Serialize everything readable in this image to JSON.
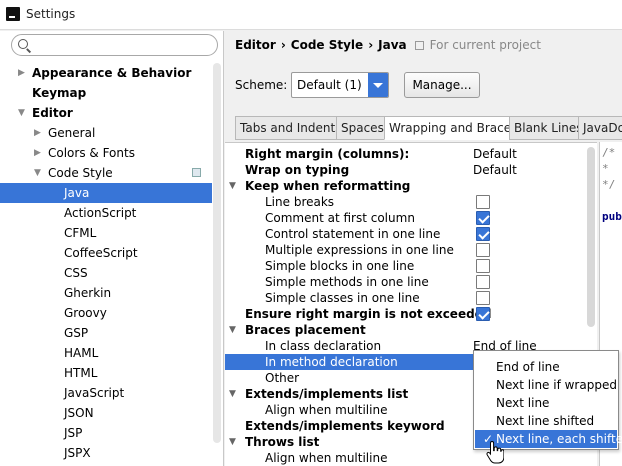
{
  "window": {
    "title": "Settings"
  },
  "sidebar": {
    "search_placeholder": "",
    "items": [
      {
        "label": "Appearance & Behavior",
        "arrow": "▶",
        "bold": true
      },
      {
        "label": "Keymap",
        "bold": true
      },
      {
        "label": "Editor",
        "arrow": "▼",
        "bold": true
      },
      {
        "label": "General",
        "arrow": "▶"
      },
      {
        "label": "Colors & Fonts",
        "arrow": "▶"
      },
      {
        "label": "Code Style",
        "arrow": "▼"
      },
      {
        "label": "Java",
        "selected": true
      },
      {
        "label": "ActionScript"
      },
      {
        "label": "CFML"
      },
      {
        "label": "CoffeeScript"
      },
      {
        "label": "CSS"
      },
      {
        "label": "Gherkin"
      },
      {
        "label": "Groovy"
      },
      {
        "label": "GSP"
      },
      {
        "label": "HAML"
      },
      {
        "label": "HTML"
      },
      {
        "label": "JavaScript"
      },
      {
        "label": "JSON"
      },
      {
        "label": "JSP"
      },
      {
        "label": "JSPX"
      }
    ]
  },
  "breadcrumb": {
    "items": [
      "Editor",
      "Code Style",
      "Java"
    ],
    "separator": "›",
    "scope": "For current project"
  },
  "scheme": {
    "label": "Scheme:",
    "value": "Default (1)",
    "manage_label": "Manage..."
  },
  "tabs": [
    "Tabs and Indents",
    "Spaces",
    "Wrapping and Braces",
    "Blank Lines",
    "JavaDoc"
  ],
  "active_tab": "Wrapping and Braces",
  "options": [
    {
      "label": "Right margin (columns):",
      "bold": true,
      "value": "Default"
    },
    {
      "label": "Wrap on typing",
      "bold": true,
      "value": "Default"
    },
    {
      "label": "Keep when reformatting",
      "bold": true,
      "group": true
    },
    {
      "label": "Line breaks",
      "checked": false
    },
    {
      "label": "Comment at first column",
      "checked": true
    },
    {
      "label": "Control statement in one line",
      "checked": true
    },
    {
      "label": "Multiple expressions in one line",
      "checked": false
    },
    {
      "label": "Simple blocks in one line",
      "checked": false
    },
    {
      "label": "Simple methods in one line",
      "checked": false
    },
    {
      "label": "Simple classes in one line",
      "checked": false
    },
    {
      "label": "Ensure right margin is not exceeded",
      "bold": true,
      "checked": true
    },
    {
      "label": "Braces placement",
      "bold": true,
      "group": true
    },
    {
      "label": "In class declaration",
      "value": "End of line"
    },
    {
      "label": "In method declaration",
      "selected": true
    },
    {
      "label": "Other"
    },
    {
      "label": "Extends/implements list",
      "bold": true,
      "group": true
    },
    {
      "label": "Align when multiline"
    },
    {
      "label": "Extends/implements keyword",
      "bold": true
    },
    {
      "label": "Throws list",
      "bold": true,
      "group": true
    },
    {
      "label": "Align when multiline"
    }
  ],
  "dropdown": {
    "options": [
      "End of line",
      "Next line if wrapped",
      "Next line",
      "Next line shifted",
      "Next line, each shifted"
    ],
    "selected": "Next line, each shifted"
  },
  "preview": {
    "lines": [
      "/*",
      " *",
      " */",
      "",
      "pub"
    ]
  },
  "colors": {
    "accent": "#3875d7"
  }
}
